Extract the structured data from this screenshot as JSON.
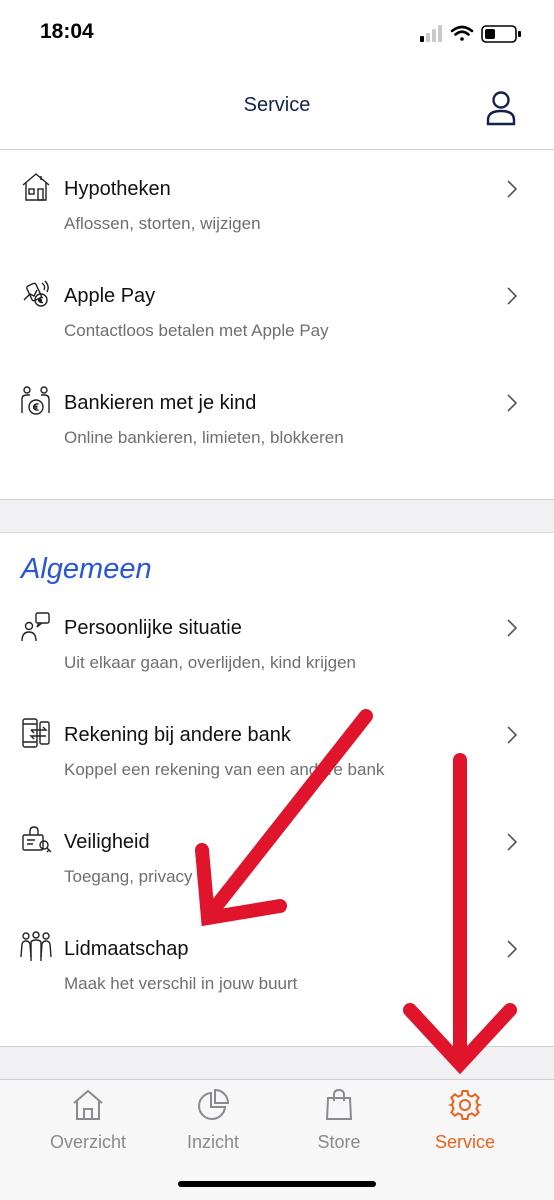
{
  "status_bar": {
    "time": "18:04"
  },
  "header": {
    "title": "Service",
    "profile_icon": "person-icon"
  },
  "top_items": [
    {
      "title": "Hypotheken",
      "subtitle": "Aflossen, storten, wijzigen",
      "icon": "house-icon"
    },
    {
      "title": "Apple Pay",
      "subtitle": "Contactloos betalen met Apple Pay",
      "icon": "contactless-pay-icon"
    },
    {
      "title": "Bankieren met je kind",
      "subtitle": "Online bankieren, limieten, blokkeren",
      "icon": "parent-child-euro-icon"
    }
  ],
  "section": {
    "title": "Algemeen",
    "items": [
      {
        "title": "Persoonlijke situatie",
        "subtitle": "Uit elkaar gaan, overlijden, kind krijgen",
        "icon": "person-speech-icon"
      },
      {
        "title": "Rekening bij andere bank",
        "subtitle": "Koppel een rekening van een andere bank",
        "icon": "phone-transfer-icon"
      },
      {
        "title": "Veiligheid",
        "subtitle": "Toegang, privacy",
        "icon": "lock-key-icon"
      },
      {
        "title": "Lidmaatschap",
        "subtitle": "Maak het verschil in jouw buurt",
        "icon": "group-people-icon"
      }
    ]
  },
  "tabs": [
    {
      "label": "Overzicht",
      "icon": "home-icon",
      "active": false
    },
    {
      "label": "Inzicht",
      "icon": "pie-chart-icon",
      "active": false
    },
    {
      "label": "Store",
      "icon": "shopping-bag-icon",
      "active": false
    },
    {
      "label": "Service",
      "icon": "gear-icon",
      "active": true
    }
  ],
  "colors": {
    "accent_orange": "#e8631b",
    "section_blue": "#2a55d8",
    "navy": "#14214d",
    "annotation_red": "#e0142b"
  }
}
